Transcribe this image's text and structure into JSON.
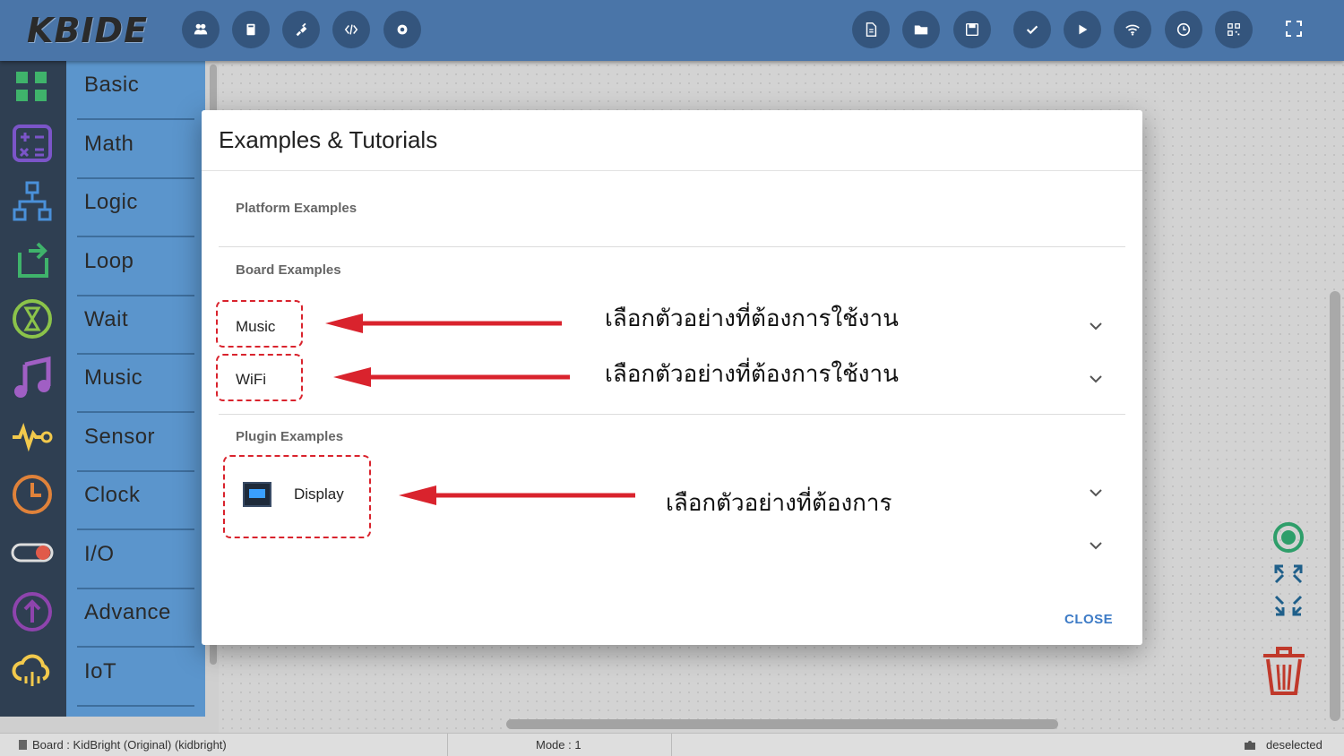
{
  "app": {
    "logo": "KBIDE"
  },
  "toolbar": {
    "left_buttons": [
      "people-icon",
      "board-icon",
      "plugin-icon",
      "code-icon",
      "settings-icon"
    ],
    "right_buttons": [
      "new-file-icon",
      "open-folder-icon",
      "save-icon",
      "check-icon",
      "play-icon",
      "wifi-icon",
      "timer-icon",
      "qr-icon"
    ],
    "fullscreen": "fullscreen-icon"
  },
  "categories": [
    {
      "label": "Basic",
      "icon": "grid-icon",
      "color": "#3fb36b"
    },
    {
      "label": "Math",
      "icon": "calculator-icon",
      "color": "#7b55c8"
    },
    {
      "label": "Logic",
      "icon": "hierarchy-icon",
      "color": "#4a90d9"
    },
    {
      "label": "Loop",
      "icon": "loop-icon",
      "color": "#3fb36b"
    },
    {
      "label": "Wait",
      "icon": "hourglass-icon",
      "color": "#8bc34a"
    },
    {
      "label": "Music",
      "icon": "music-note-icon",
      "color": "#a05fc4"
    },
    {
      "label": "Sensor",
      "icon": "sensor-wave-icon",
      "color": "#f2c94c"
    },
    {
      "label": "Clock",
      "icon": "clock-icon",
      "color": "#e0823a"
    },
    {
      "label": "I/O",
      "icon": "toggle-icon",
      "color": "#e05a4a"
    },
    {
      "label": "Advance",
      "icon": "upload-arrow-icon",
      "color": "#8e44ad"
    },
    {
      "label": "IoT",
      "icon": "cloud-icon",
      "color": "#f2c94c"
    }
  ],
  "dialog": {
    "title": "Examples & Tutorials",
    "platform_section": "Platform Examples",
    "board_section": "Board Examples",
    "board_items": [
      "Music",
      "WiFi"
    ],
    "plugin_section": "Plugin Examples",
    "plugin_items": [
      "Display"
    ],
    "close_label": "CLOSE"
  },
  "annotations": {
    "note_music": "เลือกตัวอย่างที่ต้องการใช้งาน",
    "note_wifi": "เลือกตัวอย่างที่ต้องการใช้งาน",
    "note_display": "เลือกตัวอย่างที่ต้องการ",
    "highlight_color": "#d9232d"
  },
  "status": {
    "board": "Board : KidBright (Original) (kidbright)",
    "mode": "Mode : 1",
    "selection": "deselected"
  }
}
